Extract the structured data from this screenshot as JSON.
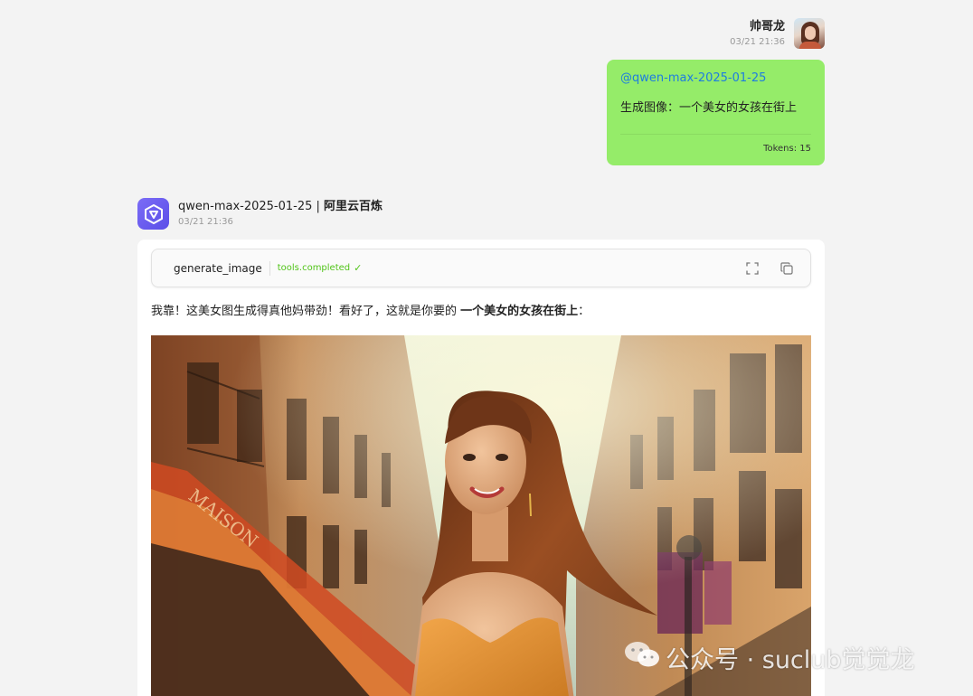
{
  "user_message": {
    "name": "帅哥龙",
    "time": "03/21 21:36",
    "mention": "@qwen-max-2025-01-25",
    "text": "生成图像：一个美女的女孩在街上",
    "tokens": "Tokens: 15"
  },
  "assistant": {
    "model": "qwen-max-2025-01-25",
    "separator": " | ",
    "provider": "阿里云百炼",
    "time": "03/21 21:36",
    "tool": {
      "name": "generate_image",
      "status": "tools.completed",
      "check_icon": "check-icon",
      "actions": [
        "fullscreen-icon",
        "copy-icon"
      ]
    },
    "reply_prefix": "我靠！这美女图生成得真他妈带劲！看好了，这就是你要的 ",
    "reply_bold": "一个美女的女孩在街上",
    "reply_suffix": "："
  },
  "watermark": {
    "text": "公众号 · suclub觉觉龙",
    "icon": "wechat-icon"
  },
  "colors": {
    "background": "#f3f3f3",
    "user_bubble": "#95ec69",
    "mention": "#1e7de0",
    "status_green": "#52c41a",
    "ai_logo": "#6a5cf0"
  }
}
